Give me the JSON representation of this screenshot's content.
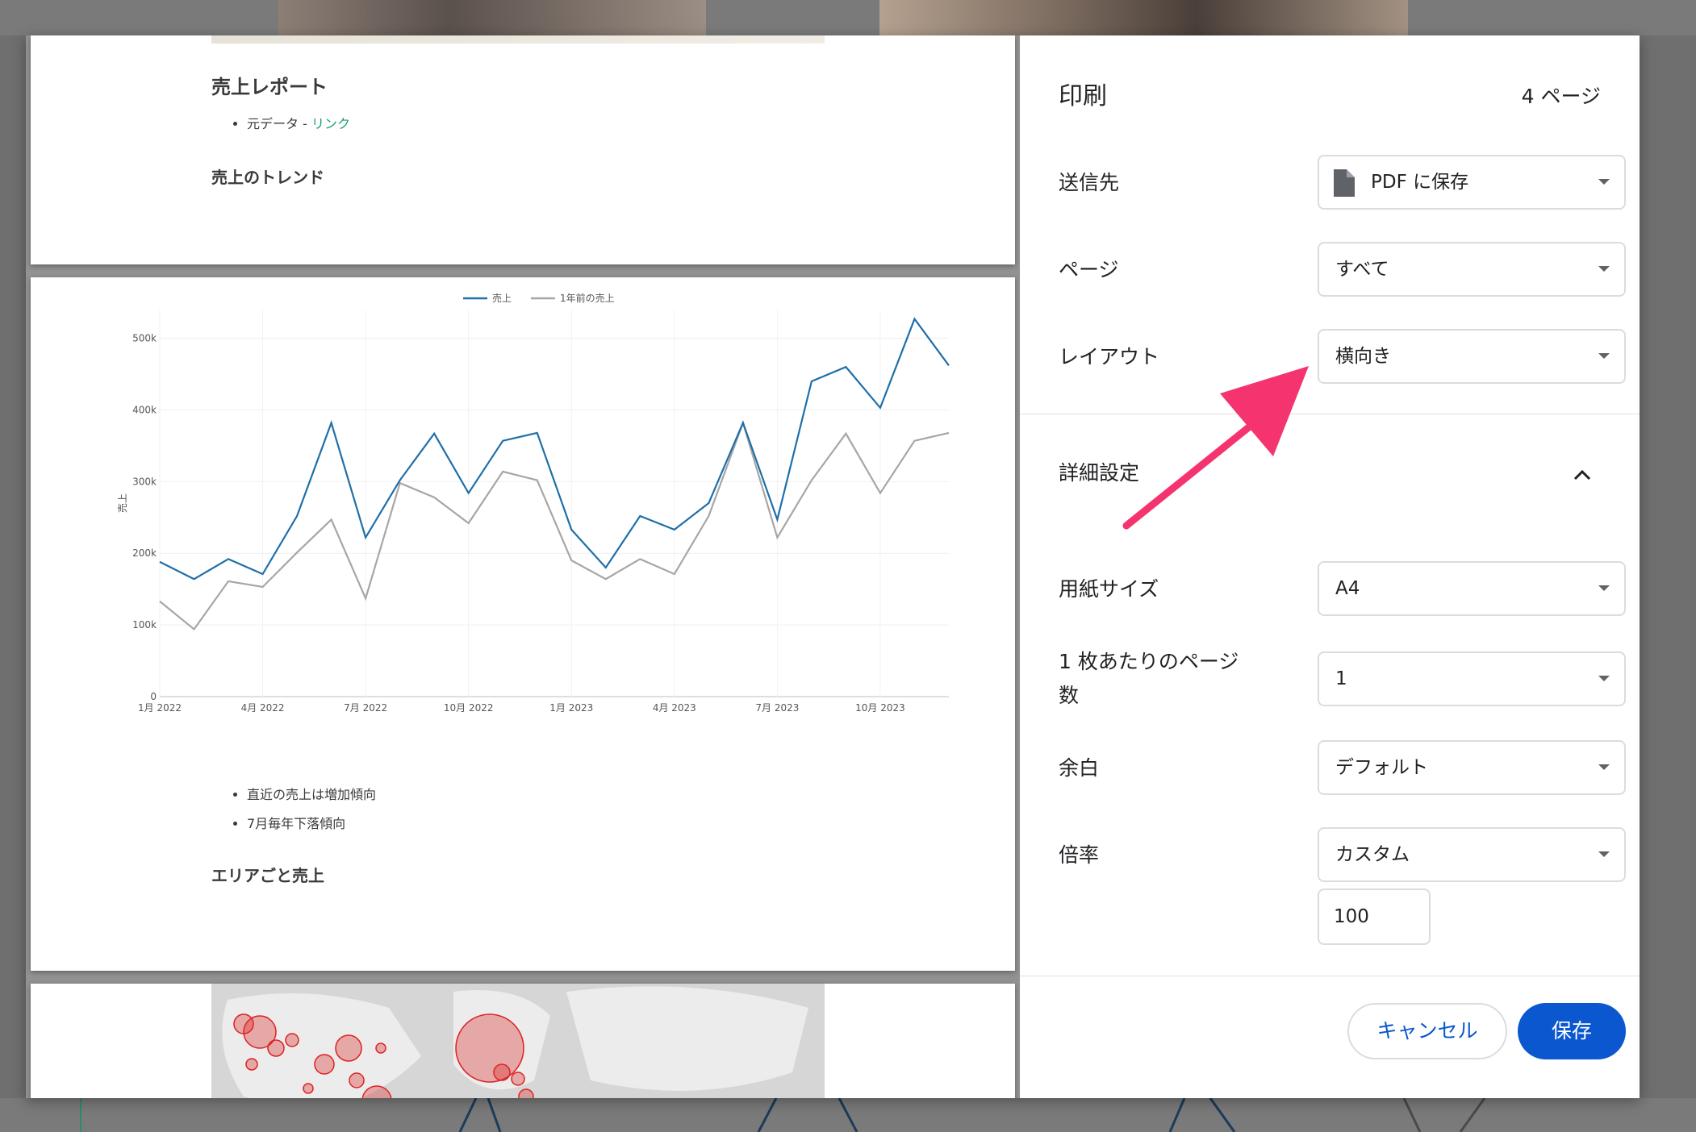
{
  "preview": {
    "report_title": "売上レポート",
    "source_prefix": "元データ - ",
    "source_link": "リンク",
    "trend_heading": "売上のトレンド",
    "bullets": [
      "直近の売上は増加傾向",
      "7月毎年下落傾向"
    ],
    "area_heading": "エリアごと売上"
  },
  "chart_data": {
    "type": "line",
    "ylabel": "売上",
    "xlabel": "",
    "x": [
      "2022-01",
      "2022-02",
      "2022-03",
      "2022-04",
      "2022-05",
      "2022-06",
      "2022-07",
      "2022-08",
      "2022-09",
      "2022-10",
      "2022-11",
      "2022-12",
      "2023-01",
      "2023-02",
      "2023-03",
      "2023-04",
      "2023-05",
      "2023-06",
      "2023-07",
      "2023-08",
      "2023-09",
      "2023-10",
      "2023-11",
      "2023-12"
    ],
    "x_ticks": [
      "1月 2022",
      "4月 2022",
      "7月 2022",
      "10月 2022",
      "1月 2023",
      "4月 2023",
      "7月 2023",
      "10月 2023"
    ],
    "y_ticks": [
      "0",
      "100k",
      "200k",
      "300k",
      "400k",
      "500k"
    ],
    "ylim": [
      0,
      540000
    ],
    "legend_position": "top-center",
    "series": [
      {
        "name": "売上",
        "color": "#1f6fa8",
        "values": [
          188000,
          164000,
          192000,
          171000,
          252000,
          382000,
          222000,
          302000,
          367000,
          284000,
          357000,
          368000,
          233000,
          180000,
          252000,
          233000,
          270000,
          382000,
          247000,
          440000,
          460000,
          403000,
          527000,
          462000
        ]
      },
      {
        "name": "1年前の売上",
        "color": "#a6a6a6",
        "values": [
          133000,
          94000,
          161000,
          153000,
          201000,
          247000,
          137000,
          298000,
          278000,
          242000,
          314000,
          302000,
          190000,
          164000,
          192000,
          171000,
          252000,
          382000,
          222000,
          302000,
          367000,
          284000,
          357000,
          368000
        ]
      }
    ]
  },
  "settings": {
    "title": "印刷",
    "page_count": "4 ページ",
    "destination": {
      "label": "送信先",
      "value": "PDF に保存"
    },
    "pages": {
      "label": "ページ",
      "value": "すべて"
    },
    "layout": {
      "label": "レイアウト",
      "value": "横向き"
    },
    "advanced": {
      "label": "詳細設定"
    },
    "paper_size": {
      "label": "用紙サイズ",
      "value": "A4"
    },
    "pages_per_sheet": {
      "label_line1": "1 枚あたりのページ",
      "label_line2": "数",
      "value": "1"
    },
    "margins": {
      "label": "余白",
      "value": "デフォルト"
    },
    "scale": {
      "label": "倍率",
      "value": "カスタム",
      "custom_value": "100"
    },
    "cancel_label": "キャンセル",
    "save_label": "保存"
  },
  "colors": {
    "accent": "#0b57d0",
    "annotation_arrow": "#f5346f",
    "link": "#1aa06d"
  }
}
